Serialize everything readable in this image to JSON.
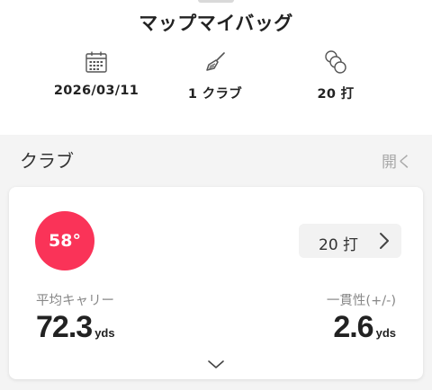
{
  "header": {
    "title": "マップマイバッグ"
  },
  "stats": [
    {
      "icon": "calendar-icon",
      "value": "2026/03/11"
    },
    {
      "icon": "golf-club-icon",
      "value": "1 クラブ"
    },
    {
      "icon": "golf-balls-icon",
      "value": "20 打"
    }
  ],
  "clubs_section": {
    "title": "クラブ",
    "open_label": "開く"
  },
  "club_card": {
    "loft": "58°",
    "loft_color": "#fa3358",
    "shots_label": "20 打",
    "avg_carry_label": "平均キャリー",
    "avg_carry_value": "72.3",
    "avg_carry_unit": "yds",
    "consistency_label": "一貫性(+/-)",
    "consistency_value": "2.6",
    "consistency_unit": "yds"
  }
}
